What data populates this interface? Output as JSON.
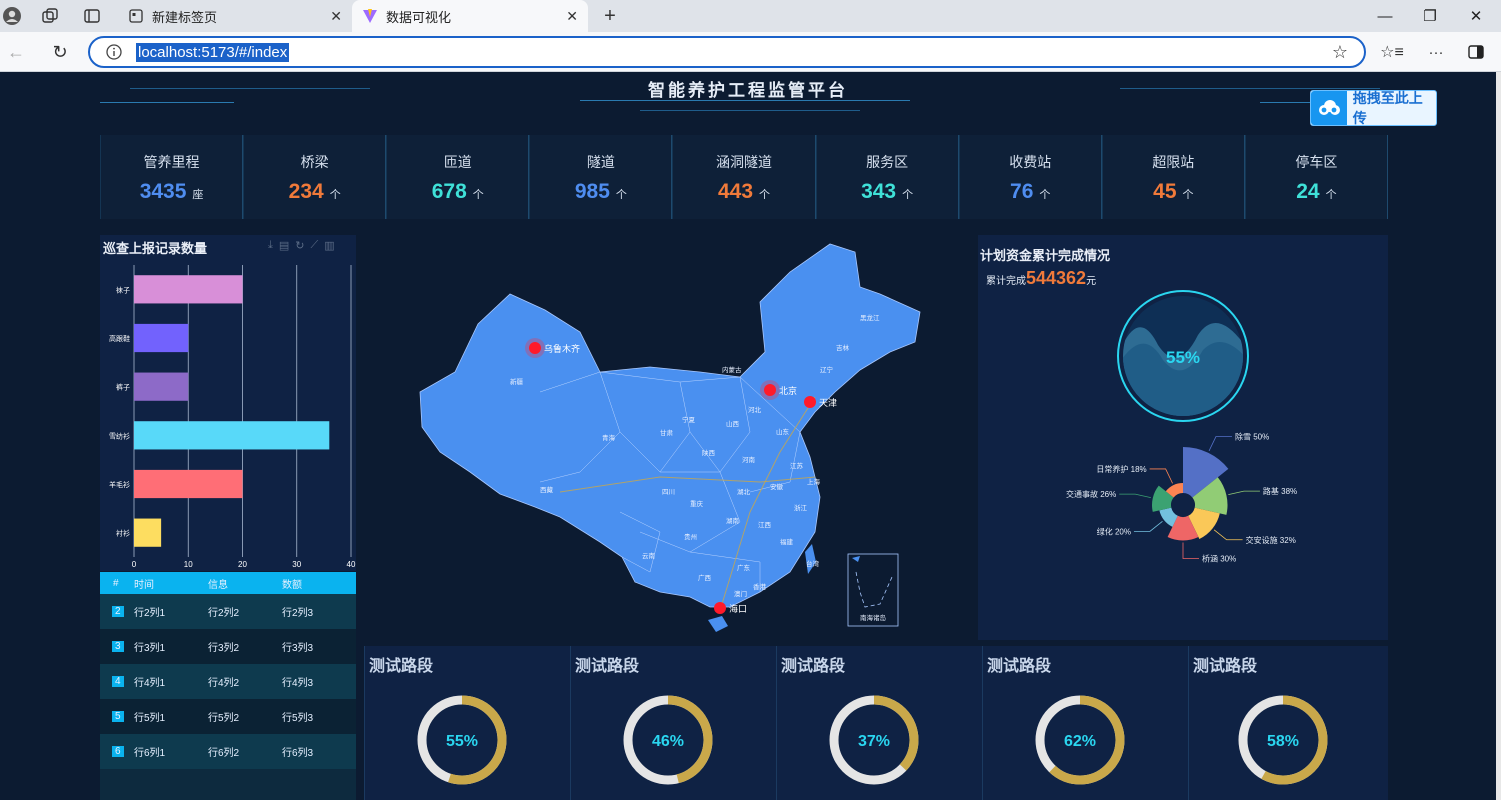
{
  "browser": {
    "tabs": [
      {
        "label": "新建标签页",
        "active": false
      },
      {
        "label": "数据可视化",
        "active": true
      }
    ],
    "url": "localhost:5173/#/index"
  },
  "header": {
    "title": "智能养护工程监管平台",
    "upload_label": "拖拽至此上传"
  },
  "stats": [
    {
      "name": "管养里程",
      "value": "3435",
      "unit": "座",
      "color": "#4f8df0"
    },
    {
      "name": "桥梁",
      "value": "234",
      "unit": "个",
      "color": "#f07a3a"
    },
    {
      "name": "匝道",
      "value": "678",
      "unit": "个",
      "color": "#3fe1d8"
    },
    {
      "name": "隧道",
      "value": "985",
      "unit": "个",
      "color": "#4f8df0"
    },
    {
      "name": "涵洞隧道",
      "value": "443",
      "unit": "个",
      "color": "#f07a3a"
    },
    {
      "name": "服务区",
      "value": "343",
      "unit": "个",
      "color": "#3fe1d8"
    },
    {
      "name": "收费站",
      "value": "76",
      "unit": "个",
      "color": "#4f8df0"
    },
    {
      "name": "超限站",
      "value": "45",
      "unit": "个",
      "color": "#f07a3a"
    },
    {
      "name": "停车区",
      "value": "24",
      "unit": "个",
      "color": "#3fe1d8"
    }
  ],
  "patrol": {
    "title": "巡查上报记录数量",
    "table_headers": [
      "#",
      "时间",
      "信息",
      "数额"
    ],
    "rows": [
      [
        "2",
        "行2列1",
        "行2列2",
        "行2列3"
      ],
      [
        "3",
        "行3列1",
        "行3列2",
        "行3列3"
      ],
      [
        "4",
        "行4列1",
        "行4列2",
        "行4列3"
      ],
      [
        "5",
        "行5列1",
        "行5列2",
        "行5列3"
      ],
      [
        "6",
        "行6列1",
        "行6列2",
        "行6列3"
      ]
    ]
  },
  "map": {
    "cities": [
      "乌鲁木齐",
      "北京",
      "天津",
      "海口"
    ],
    "inset_label": "南海诸岛",
    "provinces": [
      "新疆",
      "西藏",
      "青海",
      "甘肃",
      "内蒙古",
      "四川",
      "云南",
      "广西",
      "广东",
      "湖南",
      "湖北",
      "江西",
      "安徽",
      "江苏",
      "山东",
      "河南",
      "陕西",
      "山西",
      "河北",
      "辽宁",
      "吉林",
      "黑龙江",
      "浙江",
      "福建",
      "贵州",
      "重庆",
      "宁夏",
      "台湾",
      "上海",
      "香港",
      "澳门"
    ]
  },
  "funds": {
    "title": "计划资金累计完成情况",
    "label": "累计完成",
    "amount": "544362",
    "unit": "元",
    "percent_label": "55%"
  },
  "chart_data": [
    {
      "type": "bar",
      "orientation": "horizontal",
      "categories": [
        "衬衫",
        "羊毛衫",
        "雪纺衫",
        "裤子",
        "高跟鞋",
        "袜子"
      ],
      "values": [
        5,
        20,
        36,
        10,
        10,
        20
      ],
      "colors": [
        "#fddd60",
        "#ff6e76",
        "#58d9f9",
        "#8d6ac8",
        "#7262fd",
        "#d88fd8"
      ],
      "xlim": [
        0,
        40
      ],
      "xticks": [
        "0",
        "10",
        "20",
        "30",
        "40"
      ]
    },
    {
      "type": "pie",
      "variant": "rose",
      "labels": [
        "除雪",
        "路基",
        "交安设施",
        "桥涵",
        "绿化",
        "交通事故",
        "日常养护"
      ],
      "values": [
        50,
        38,
        32,
        30,
        20,
        26,
        18
      ],
      "label_texts": [
        "除雪 50%",
        "路基 38%",
        "交安设施 32%",
        "桥涵 30%",
        "绿化 20%",
        "交通事故 26%",
        "日常养护 18%"
      ],
      "colors": [
        "#5470c6",
        "#91cc75",
        "#fac858",
        "#ee6666",
        "#73c0de",
        "#3ba272",
        "#fc8452"
      ]
    },
    {
      "type": "pie",
      "variant": "gauges",
      "labels": [
        "测试路段",
        "测试路段",
        "测试路段",
        "测试路段",
        "测试路段"
      ],
      "values": [
        55,
        46,
        37,
        62,
        58
      ],
      "value_labels": [
        "55%",
        "46%",
        "37%",
        "62%",
        "58%"
      ]
    }
  ],
  "colors": {
    "accent": "#1b62c9",
    "map": "#4a90f0",
    "gauge": "#c9a84a",
    "cyan": "#2ad6f0"
  }
}
